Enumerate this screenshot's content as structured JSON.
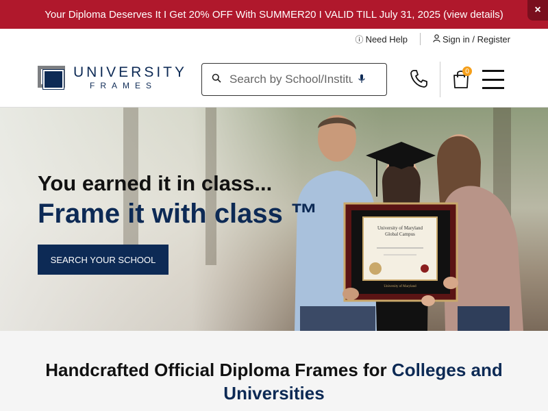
{
  "promo": {
    "text": "Your Diploma Deserves It I  Get 20% OFF With SUMMER20 I VALID TILL July 31, 2025 (view details)",
    "close_label": "×",
    "bg_color": "#b0182c"
  },
  "utility": {
    "help_label": "Need Help",
    "help_icon": "info-circle-icon",
    "signin_label": "Sign in / Register",
    "signin_icon": "user-icon"
  },
  "logo": {
    "word1": "UNIVERSITY",
    "word2": "FRAMES"
  },
  "search": {
    "placeholder": "Search by School/Institution",
    "icon": "search-icon",
    "mic_icon": "microphone-icon"
  },
  "header": {
    "phone_icon": "phone-icon",
    "cart_icon": "shopping-bag-icon",
    "cart_count": "0",
    "menu_icon": "hamburger-menu-icon"
  },
  "hero": {
    "line1": "You earned it in class...",
    "line2": "Frame it with class ™",
    "cta_label": "SEARCH YOUR SCHOOL",
    "diploma_school": "University of Maryland Global Campus"
  },
  "section": {
    "heading_part1": "Handcrafted Official Diploma Frames for",
    "heading_part2": "Colleges and Universities"
  },
  "colors": {
    "brand_navy": "#0d2a55",
    "promo_red": "#b0182c",
    "badge_orange": "#f59f1a"
  }
}
